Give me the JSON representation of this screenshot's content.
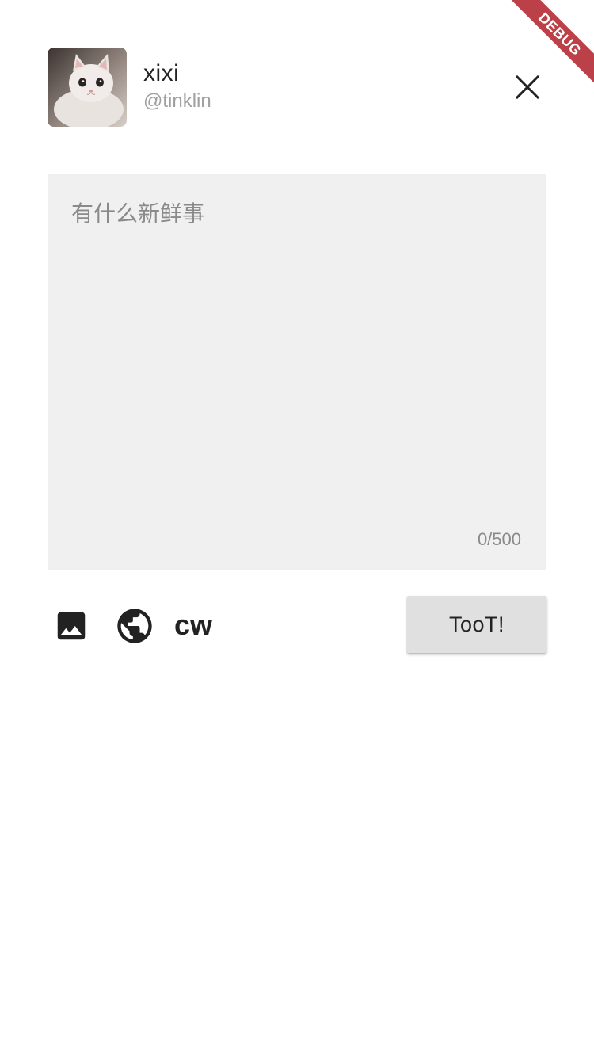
{
  "profile": {
    "display_name": "xixi",
    "username": "@tinklin",
    "avatar_icon": "cat-avatar"
  },
  "header": {
    "close_icon": "close-icon"
  },
  "debug_banner": {
    "label": "DEBUG"
  },
  "compose": {
    "placeholder": "有什么新鲜事",
    "value": "",
    "counter": "0/500"
  },
  "toolbar": {
    "image_icon": "image-icon",
    "visibility_icon": "globe-icon",
    "cw_label": "cw",
    "toot_label": "TooT!"
  },
  "colors": {
    "compose_background": "#f0f0f0",
    "button_background": "#e0e0e0",
    "debug_ribbon": "#b01e28"
  }
}
